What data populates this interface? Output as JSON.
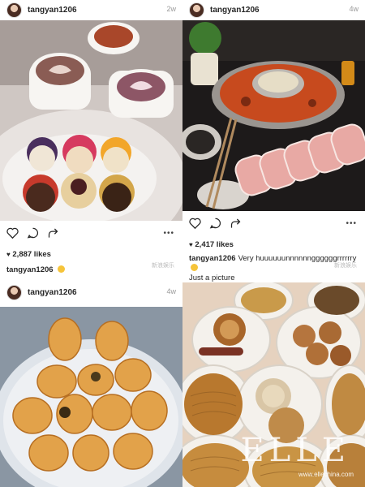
{
  "posts": [
    {
      "username": "tangyan1206",
      "age": "2w",
      "likes": "2,887 likes",
      "caption_user": "tangyan1206",
      "caption_text": "",
      "watermark": "新浪娱乐"
    },
    {
      "username": "tangyan1206",
      "age": "4w",
      "likes": "2,417 likes",
      "caption_user": "tangyan1206",
      "caption_text": "Very huuuuuunnnnnnggggggrrrrrry",
      "caption_line2": "Just a picture",
      "watermark": "新浪娱乐"
    },
    {
      "username": "tangyan1206",
      "age": "4w"
    }
  ],
  "overlay": {
    "brand": "ELLE",
    "url": "www.ellechina.com"
  },
  "icons": [
    "heart-icon",
    "comment-icon",
    "share-icon",
    "more-icon"
  ]
}
